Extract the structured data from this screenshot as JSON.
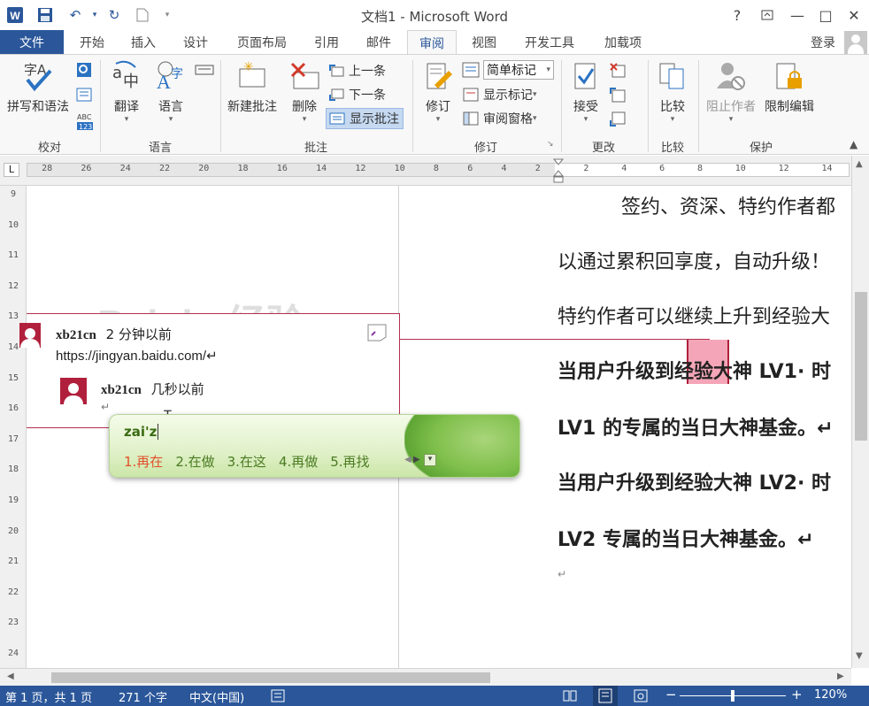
{
  "titlebar": {
    "title": "文档1 - Microsoft Word",
    "help": "?",
    "minimize": "—",
    "maximize": "□",
    "close": "✕"
  },
  "tabs": {
    "file": "文件",
    "items": [
      "开始",
      "插入",
      "设计",
      "页面布局",
      "引用",
      "邮件",
      "审阅",
      "视图",
      "开发工具",
      "加载项"
    ],
    "active": "审阅",
    "login": "登录"
  },
  "ribbon": {
    "proofing": {
      "spell": "拼写和语法",
      "label": "校对"
    },
    "language": {
      "translate": "翻译",
      "language": "语言",
      "label": "语言"
    },
    "comments": {
      "new": "新建批注",
      "delete": "删除",
      "prev": "上一条",
      "next": "下一条",
      "show": "显示批注",
      "label": "批注"
    },
    "tracking": {
      "track": "修订",
      "markup_select": "简单标记",
      "show_markup": "显示标记",
      "pane": "审阅窗格",
      "label": "修订"
    },
    "changes": {
      "accept": "接受",
      "label": "更改"
    },
    "compare": {
      "compare": "比较",
      "label": "比较"
    },
    "protect": {
      "block": "阻止作者",
      "restrict": "限制编辑",
      "label": "保护"
    }
  },
  "ruler": {
    "left_marks": [
      "28",
      "26",
      "24",
      "22",
      "20",
      "18",
      "16",
      "14",
      "12",
      "10",
      "8",
      "6",
      "4",
      "2"
    ],
    "right_marks": [
      "2",
      "4",
      "6",
      "8",
      "10",
      "12",
      "14"
    ],
    "vertical_marks": [
      "9",
      "10",
      "11",
      "12",
      "13",
      "14",
      "15",
      "16",
      "17",
      "18",
      "19",
      "20",
      "21",
      "22",
      "23",
      "24"
    ]
  },
  "document": {
    "lines": [
      "签约、资深、特约作者都",
      "以通过累积回享度，自动升级！",
      "特约作者可以继续上升到经验大",
      "当用户升级到经验大神 LV1· 时",
      "LV1 的专属的当日大神基金。↵",
      "当用户升级到经验大神 LV2· 时",
      "LV2 专属的当日大神基金。↵",
      "↵"
    ]
  },
  "comment": {
    "author": "xb21cn",
    "time": "2 分钟以前",
    "text": "https://jingyan.baidu.com/↵",
    "reply_author": "xb21cn",
    "reply_time": "几秒以前",
    "reply_text": "↵"
  },
  "watermark": "Bai du 经验",
  "ime": {
    "input": "zai'z",
    "candidates": [
      "1.再在",
      "2.在做",
      "3.在这",
      "4.再做",
      "5.再找"
    ]
  },
  "status": {
    "page": "第 1 页，共 1 页",
    "words": "271 个字",
    "lang": "中文(中国)",
    "zoom": "120%"
  },
  "colors": {
    "brand": "#2b579a",
    "comment_accent": "#b0203c",
    "highlight": "#f4a6b8"
  }
}
